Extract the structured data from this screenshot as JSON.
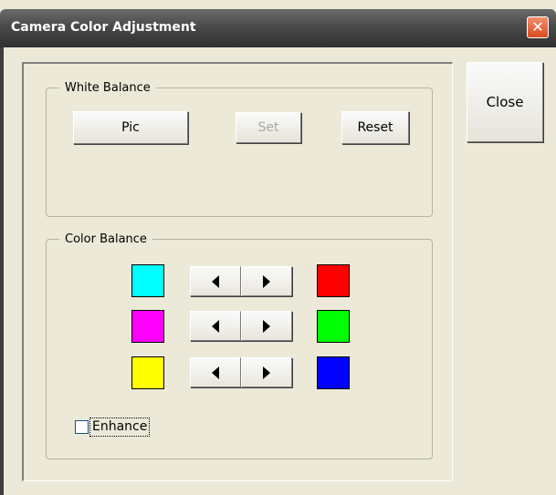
{
  "window": {
    "title": "Camera Color Adjustment",
    "close_icon": "close-x-icon"
  },
  "side_buttons": {
    "close_label": "Close"
  },
  "white_balance": {
    "label": "White Balance",
    "pic_label": "Pic",
    "set_label": "Set",
    "set_enabled": false,
    "reset_label": "Reset"
  },
  "color_balance": {
    "label": "Color Balance",
    "rows": [
      {
        "left_color": "#00ffff",
        "right_color": "#ff0000"
      },
      {
        "left_color": "#ff00ff",
        "right_color": "#00ff00"
      },
      {
        "left_color": "#ffff00",
        "right_color": "#0000ff"
      }
    ],
    "enhance_label": "Enhance",
    "enhance_checked": false
  },
  "colors": {
    "dialog_bg": "#ece9d8",
    "titlebar": "#4a4a4a",
    "close_accent": "#d94a1e"
  }
}
